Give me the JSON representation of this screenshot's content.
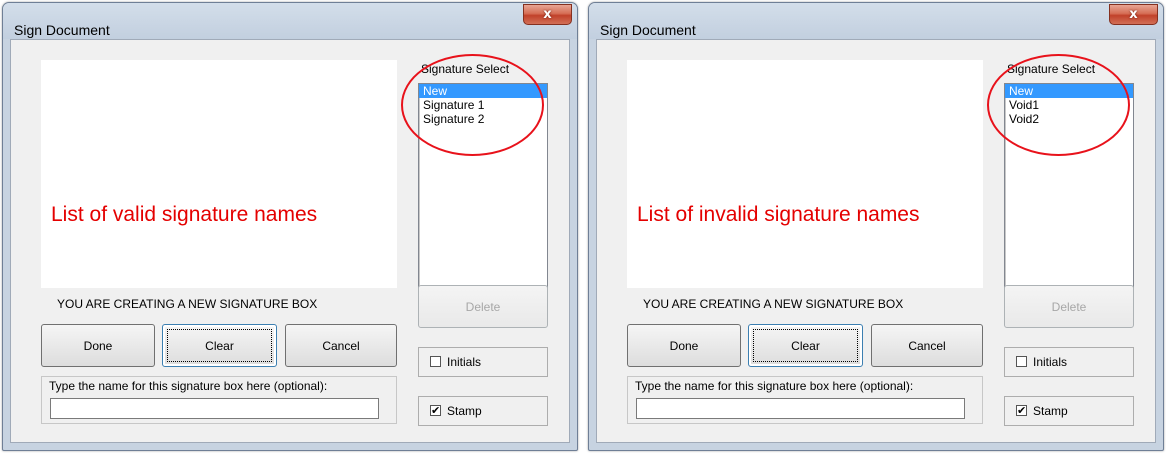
{
  "dialogs": [
    {
      "title": "Sign Document",
      "close_label": "x",
      "annotation": "List of valid signature names",
      "signature_select": {
        "label": "Signature Select",
        "items": [
          "New",
          "Signature 1",
          "Signature 2"
        ],
        "selected_index": 0
      },
      "status": "YOU ARE CREATING A NEW SIGNATURE BOX",
      "buttons": {
        "done": "Done",
        "clear": "Clear",
        "cancel": "Cancel",
        "delete": "Delete"
      },
      "name_field": {
        "label": "Type the name for this signature box here (optional):",
        "value": ""
      },
      "initials": {
        "label": "Initials",
        "checked": false
      },
      "stamp": {
        "label": "Stamp",
        "checked": true
      }
    },
    {
      "title": "Sign Document",
      "close_label": "x",
      "annotation": "List of invalid signature names",
      "signature_select": {
        "label": "Signature Select",
        "items": [
          "New",
          "Void1",
          "Void2"
        ],
        "selected_index": 0
      },
      "status": "YOU ARE CREATING A NEW SIGNATURE BOX",
      "buttons": {
        "done": "Done",
        "clear": "Clear",
        "cancel": "Cancel",
        "delete": "Delete"
      },
      "name_field": {
        "label": "Type the name for this signature box here (optional):",
        "value": ""
      },
      "initials": {
        "label": "Initials",
        "checked": false
      },
      "stamp": {
        "label": "Stamp",
        "checked": true
      }
    }
  ],
  "colors": {
    "annotation": "#e40000",
    "selection": "#3399ff",
    "dialog_frame": "#c7d3e1"
  }
}
